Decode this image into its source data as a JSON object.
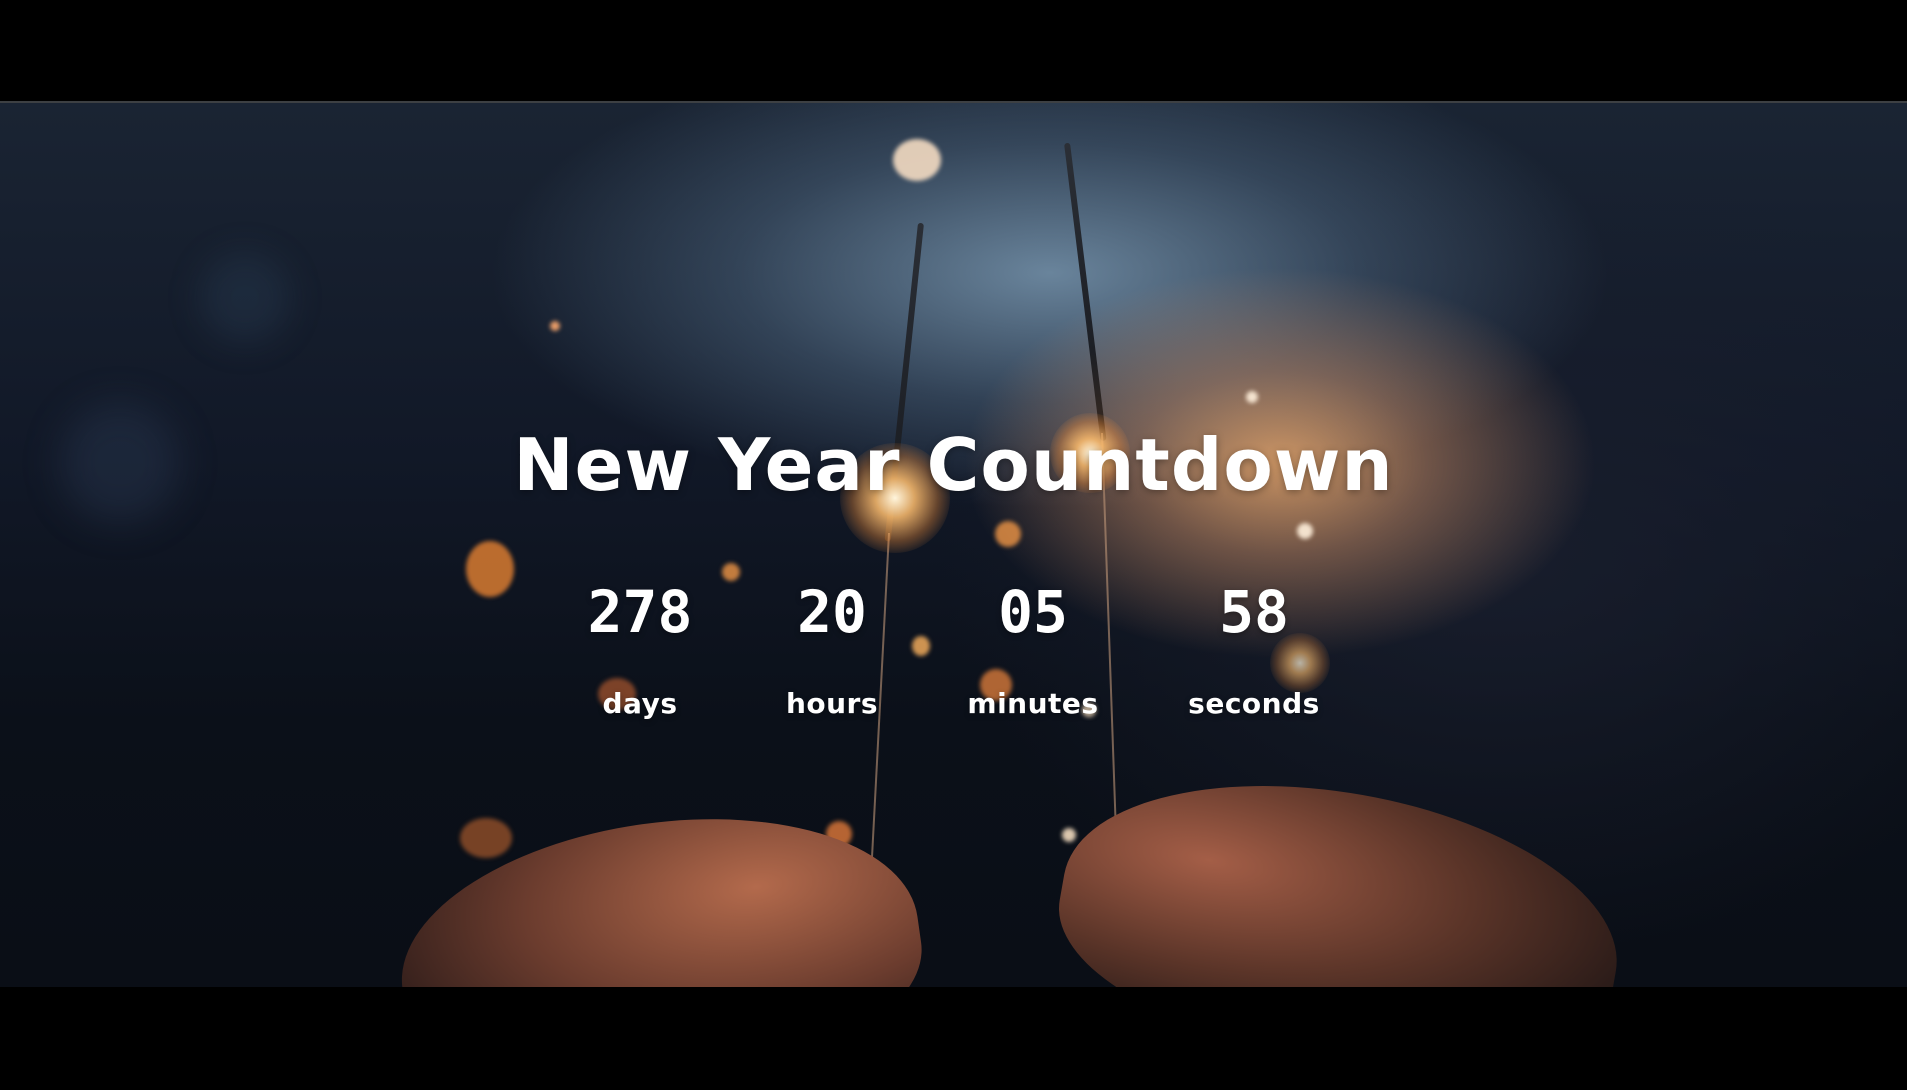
{
  "page": {
    "title": "New Year Countdown"
  },
  "countdown": [
    {
      "value": "278",
      "unit": "days"
    },
    {
      "value": "20",
      "unit": "hours"
    },
    {
      "value": "05",
      "unit": "minutes"
    },
    {
      "value": "58",
      "unit": "seconds"
    }
  ],
  "theme": {
    "text_color": "#ffffff",
    "letterbox_color": "#000000"
  }
}
